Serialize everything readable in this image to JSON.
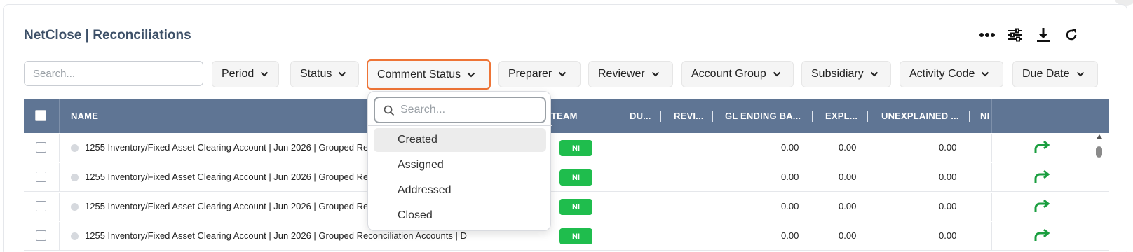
{
  "app_title": "NetClose | Reconciliations",
  "toolbar": {
    "icons": [
      "more-horizontal-icon",
      "settings-sliders-icon",
      "download-icon",
      "refresh-icon"
    ]
  },
  "search": {
    "placeholder": "Search..."
  },
  "filters": [
    {
      "label": "Period"
    },
    {
      "label": "Status"
    },
    {
      "label": "Comment Status",
      "active": true
    },
    {
      "label": "Preparer"
    },
    {
      "label": "Reviewer"
    },
    {
      "label": "Account Group"
    },
    {
      "label": "Subsidiary"
    },
    {
      "label": "Activity Code"
    },
    {
      "label": "Due Date"
    }
  ],
  "table": {
    "columns": [
      "NAME",
      "TEAM",
      "DU...",
      "REVI...",
      "GL ENDING BA...",
      "EXPL...",
      "UNEXPLAINED ...",
      "NI"
    ],
    "rows": [
      {
        "name": "1255 Inventory/Fixed Asset Clearing Account | Jun 2026 | Grouped Reconciliation Accounts | D",
        "team": "NI",
        "gl": "0.00",
        "expl": "0.00",
        "unexpl": "0.00"
      },
      {
        "name": "1255 Inventory/Fixed Asset Clearing Account | Jun 2026 | Grouped Reconciliation Accounts | D",
        "team": "NI",
        "gl": "0.00",
        "expl": "0.00",
        "unexpl": "0.00"
      },
      {
        "name": "1255 Inventory/Fixed Asset Clearing Account | Jun 2026 | Grouped Reconciliation Accounts | D",
        "team": "NI",
        "gl": "0.00",
        "expl": "0.00",
        "unexpl": "0.00"
      },
      {
        "name": "1255 Inventory/Fixed Asset Clearing Account | Jun 2026 | Grouped Reconciliation Accounts | D",
        "team": "NI",
        "gl": "0.00",
        "expl": "0.00",
        "unexpl": "0.00"
      }
    ]
  },
  "dropdown": {
    "search_placeholder": "Search...",
    "options": [
      "Created",
      "Assigned",
      "Addressed",
      "Closed"
    ],
    "hovered": "Created"
  },
  "colors": {
    "header_bg": "#5f7594",
    "accent_outline": "#ee7436",
    "team_badge": "#1fbd4d",
    "action_arrow": "#1a9e3f"
  }
}
